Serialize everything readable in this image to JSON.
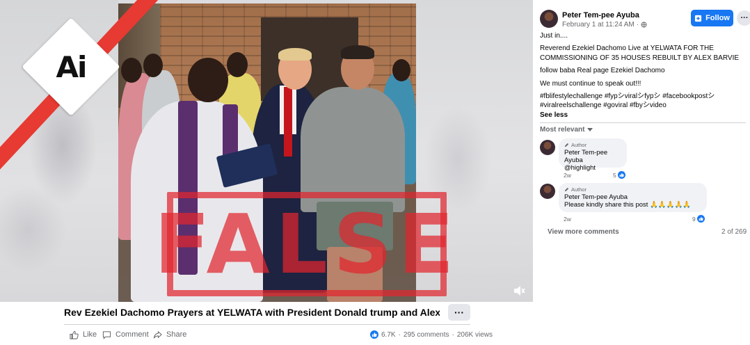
{
  "media": {
    "badge_text": "Ai",
    "stamp_text": "FALSE",
    "accent_red": "#e63a32"
  },
  "caption": {
    "title": "Rev Ezekiel Dachomo Prayers at YELWATA with President Donald trump and Alex B...",
    "more_label": "···"
  },
  "actions": {
    "like": "Like",
    "comment": "Comment",
    "share": "Share"
  },
  "stats": {
    "reactions": "6.7K",
    "comments": "295 comments",
    "views": "206K views"
  },
  "post": {
    "author": "Peter Tem-pee Ayuba",
    "date": "February 1 at 11:24 AM",
    "separator": "·",
    "follow_label": "Follow",
    "more_label": "···",
    "lines": [
      "Just in....",
      "Reverend Ezekiel Dachomo Live at YELWATA FOR THE COMMISSIONING OF 35 HOUSES REBUILT BY ALEX BARVIE",
      "follow baba Real page Ezekiel Dachomo",
      "We must continue to speak out!!!",
      "#fblifestylechallenge #fypシviralシfypシ #facebookpostシ #viralreelschallenge #goviral #fbyシvideo"
    ],
    "see_less": "See less",
    "brand_color": "#1877f2"
  },
  "comments_section": {
    "sort_label": "Most relevant",
    "comments": [
      {
        "tag": "Author",
        "name": "Peter Tem-pee Ayuba",
        "text": "@highlight",
        "time": "2w",
        "likes": "5"
      },
      {
        "tag": "Author",
        "name": "Peter Tem-pee Ayuba",
        "text": "Please kindly share this post 🙏🙏🙏🙏🙏",
        "time": "2w",
        "likes": "9"
      }
    ],
    "view_more": "View more comments",
    "count": "2 of 269"
  }
}
